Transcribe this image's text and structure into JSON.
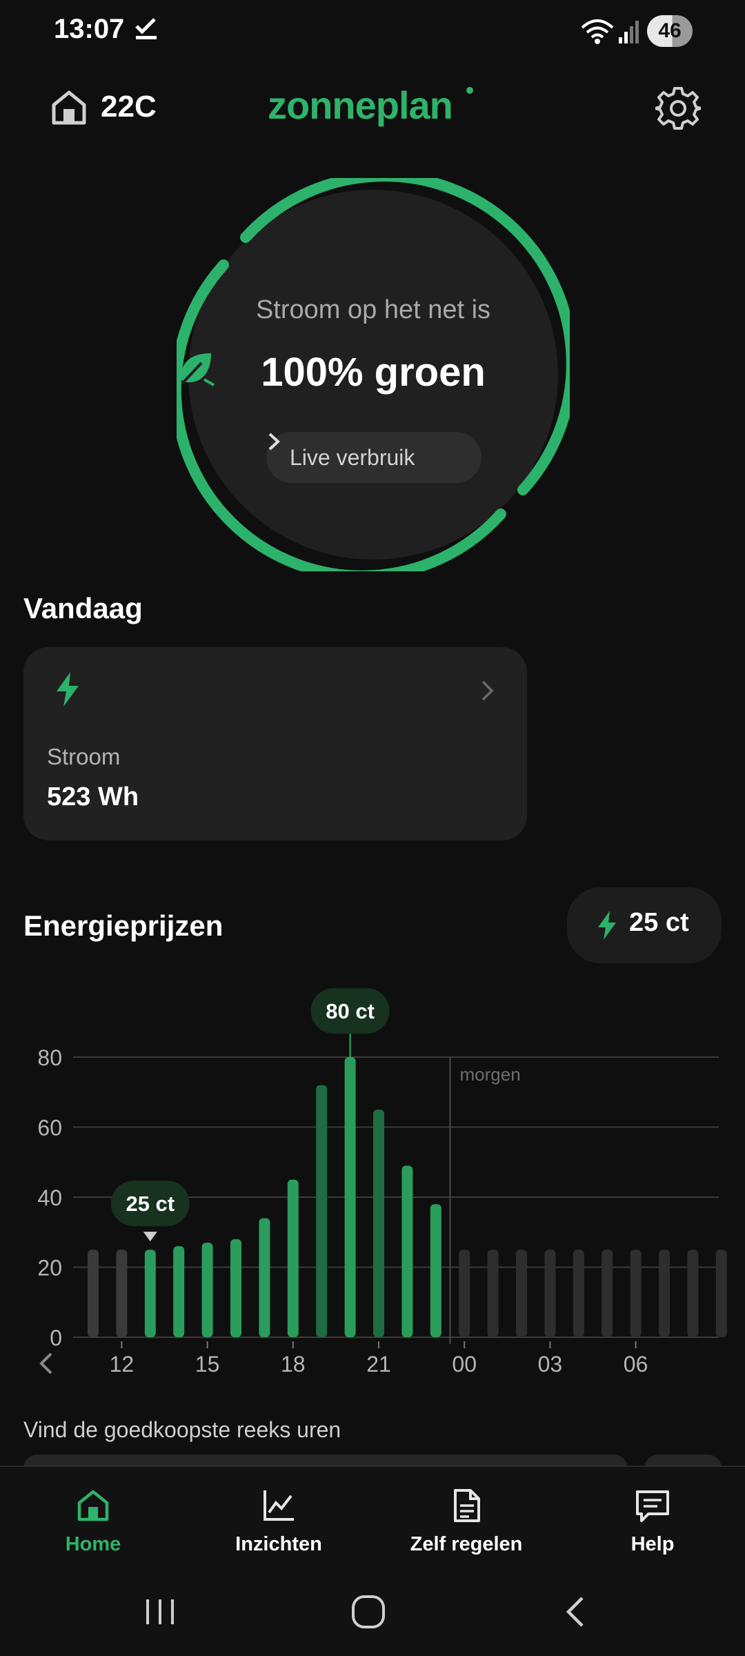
{
  "status_bar": {
    "time": "13:07",
    "battery": "46",
    "icons": [
      "check-icon",
      "wifi-icon",
      "signal-icon",
      "battery-icon"
    ]
  },
  "header": {
    "home_label": "22C",
    "logo": "zonneplan",
    "settings_icon": "gear-icon"
  },
  "hero": {
    "subtitle": "Stroom op het net is",
    "main": "100% groen",
    "live_button": "Live verbruik",
    "green_percent": 100
  },
  "today": {
    "title": "Vandaag",
    "card_label": "Stroom",
    "card_value": "523 Wh"
  },
  "prices": {
    "title": "Energieprijzen",
    "current_price": "25 ct",
    "cheapest_title": "Vind de goedkoopste reeks uren"
  },
  "chart_data": {
    "type": "bar",
    "unit": "ct",
    "yticks": [
      "0",
      "20",
      "40",
      "60",
      "80"
    ],
    "ylim": [
      0,
      80
    ],
    "xticks": [
      "12",
      "15",
      "18",
      "21",
      "00",
      "03",
      "06"
    ],
    "tomorrow_label": "morgen",
    "current_callout": "25 ct",
    "max_callout": "80 ct",
    "hours": [
      11,
      12,
      13,
      14,
      15,
      16,
      17,
      18,
      19,
      20,
      21,
      22,
      23,
      0,
      1,
      2,
      3,
      4,
      5,
      6,
      7,
      8,
      9
    ],
    "values": [
      25,
      25,
      25,
      26,
      27,
      28,
      34,
      45,
      72,
      80,
      65,
      49,
      38,
      25,
      25,
      25,
      25,
      25,
      25,
      25,
      25,
      25,
      25
    ],
    "current_index": 2,
    "max_index": 9,
    "colors": {
      "past": "#3a3a3a",
      "today": "#2a9d5c",
      "today_dark": "#1f6d42",
      "tomorrow": "#2e2e2e",
      "accent": "#2fb36a"
    },
    "grid": true
  },
  "nav": {
    "items": [
      {
        "label": "Home",
        "icon": "home-icon",
        "active": true
      },
      {
        "label": "Inzichten",
        "icon": "chart-icon",
        "active": false
      },
      {
        "label": "Zelf regelen",
        "icon": "document-icon",
        "active": false
      },
      {
        "label": "Help",
        "icon": "chat-icon",
        "active": false
      }
    ]
  }
}
